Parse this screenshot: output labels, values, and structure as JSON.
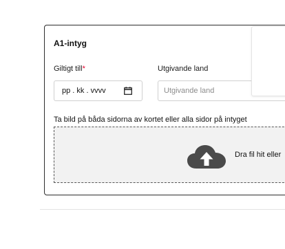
{
  "card": {
    "title": "A1-intyg"
  },
  "fields": {
    "valid_until_label": "Giltigt till",
    "valid_until_required_mark": "*",
    "valid_until_placeholder": "pp . kk . vvvv",
    "country_label": "Utgivande land",
    "country_placeholder": "Utgivande land"
  },
  "upload": {
    "hint": "Ta bild på båda sidorna av kortet eller alla sidor på intyget",
    "drop_text": "Dra fil hit eller"
  },
  "icons": {
    "calendar": "calendar-icon",
    "upload": "cloud-upload-icon"
  },
  "colors": {
    "required": "#e4002b",
    "border": "#2b2b2b",
    "dropzone_bg": "#f2f2f2",
    "cloud": "#4a4a4a"
  }
}
